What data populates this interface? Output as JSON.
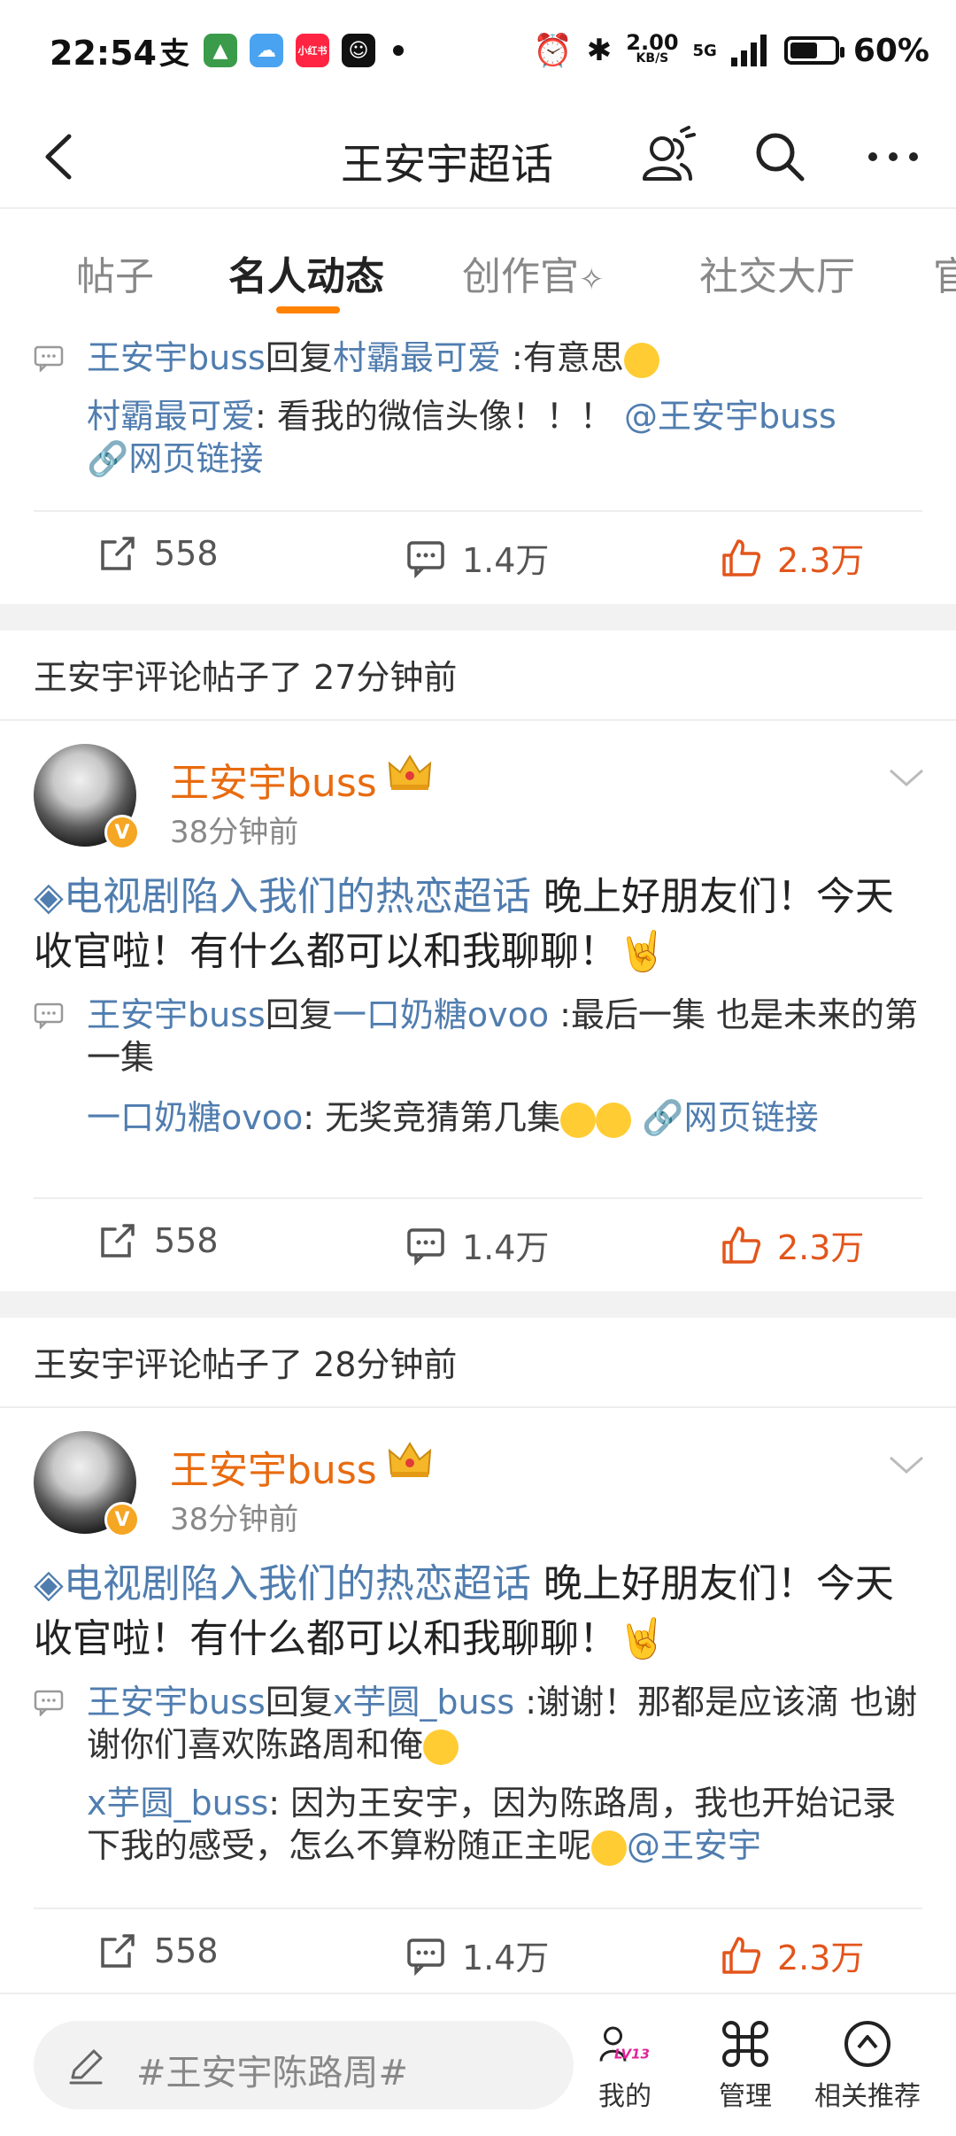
{
  "status_bar": {
    "time": "22:54",
    "net_speed_value": "2.00",
    "net_speed_unit": "KB/S",
    "network": "5G",
    "battery": "60%",
    "left_icons": [
      "alipay-icon",
      "game-app-icon",
      "weather-app-icon",
      "xiaohongshu-icon",
      "smiley-app-icon",
      "dot-icon"
    ],
    "xiaohongshu_label": "小红书"
  },
  "nav": {
    "title": "王安宇超话",
    "icons": [
      "back-icon",
      "friends-icon",
      "search-icon",
      "more-icon"
    ]
  },
  "tabs": [
    {
      "label": "帖子",
      "active": false
    },
    {
      "label": "名人动态",
      "active": true
    },
    {
      "label": "创作官",
      "active": false
    },
    {
      "label": "社交大厅",
      "active": false
    },
    {
      "label": "官",
      "active": false
    }
  ],
  "feed": [
    {
      "reply": {
        "author": "王安宇buss",
        "verb": "回复",
        "target": "村霸最可爱",
        "text": " :有意思"
      },
      "quote": {
        "author": "村霸最可爱",
        "text": ": 看我的微信头像！！！",
        "mention": "@王安宇buss",
        "link": "网页链接"
      },
      "actions": {
        "share": "558",
        "comment": "1.4万",
        "like": "2.3万"
      }
    },
    {
      "header": "王安宇评论帖子了 27分钟前",
      "user": {
        "name": "王安宇buss",
        "time": "38分钟前",
        "badge": "V"
      },
      "post": {
        "topic": "电视剧陷入我们的热恋超话",
        "text": " 晚上好朋友们！今天收官啦！有什么都可以和我聊聊！"
      },
      "reply": {
        "author": "王安宇buss",
        "verb": "回复",
        "target": "一口奶糖ovoo",
        "text": " :最后一集 也是未来的第一集"
      },
      "quote": {
        "author": "一口奶糖ovoo",
        "text": ": 无奖竞猜第几集",
        "link": "网页链接"
      },
      "actions": {
        "share": "558",
        "comment": "1.4万",
        "like": "2.3万"
      }
    },
    {
      "header": "王安宇评论帖子了 28分钟前",
      "user": {
        "name": "王安宇buss",
        "time": "38分钟前",
        "badge": "V"
      },
      "post": {
        "topic": "电视剧陷入我们的热恋超话",
        "text": " 晚上好朋友们！今天收官啦！有什么都可以和我聊聊！"
      },
      "reply": {
        "author": "王安宇buss",
        "verb": "回复",
        "target": "x芋圆_buss",
        "text": " :谢谢！那都是应该滴 也谢谢你们喜欢陈路周和俺"
      },
      "quote": {
        "author": "x芋圆_buss",
        "text": ": 因为王安宇，因为陈路周，我也开始记录下我的感受，怎么不算粉随正主呢",
        "mention": "@王安宇"
      },
      "actions": {
        "share": "558",
        "comment": "1.4万",
        "like": "2.3万"
      }
    }
  ],
  "bottom_bar": {
    "composer_placeholder": "#王安宇陈路周#",
    "level_badge": "LV13",
    "items": [
      {
        "label": "我的",
        "icon": "profile-level-icon"
      },
      {
        "label": "管理",
        "icon": "command-icon"
      },
      {
        "label": "相关推荐",
        "icon": "compass-icon"
      }
    ]
  },
  "colors": {
    "accent": "#ff8200",
    "link": "#507daf",
    "like": "#e2551b",
    "username": "#e86b10"
  }
}
